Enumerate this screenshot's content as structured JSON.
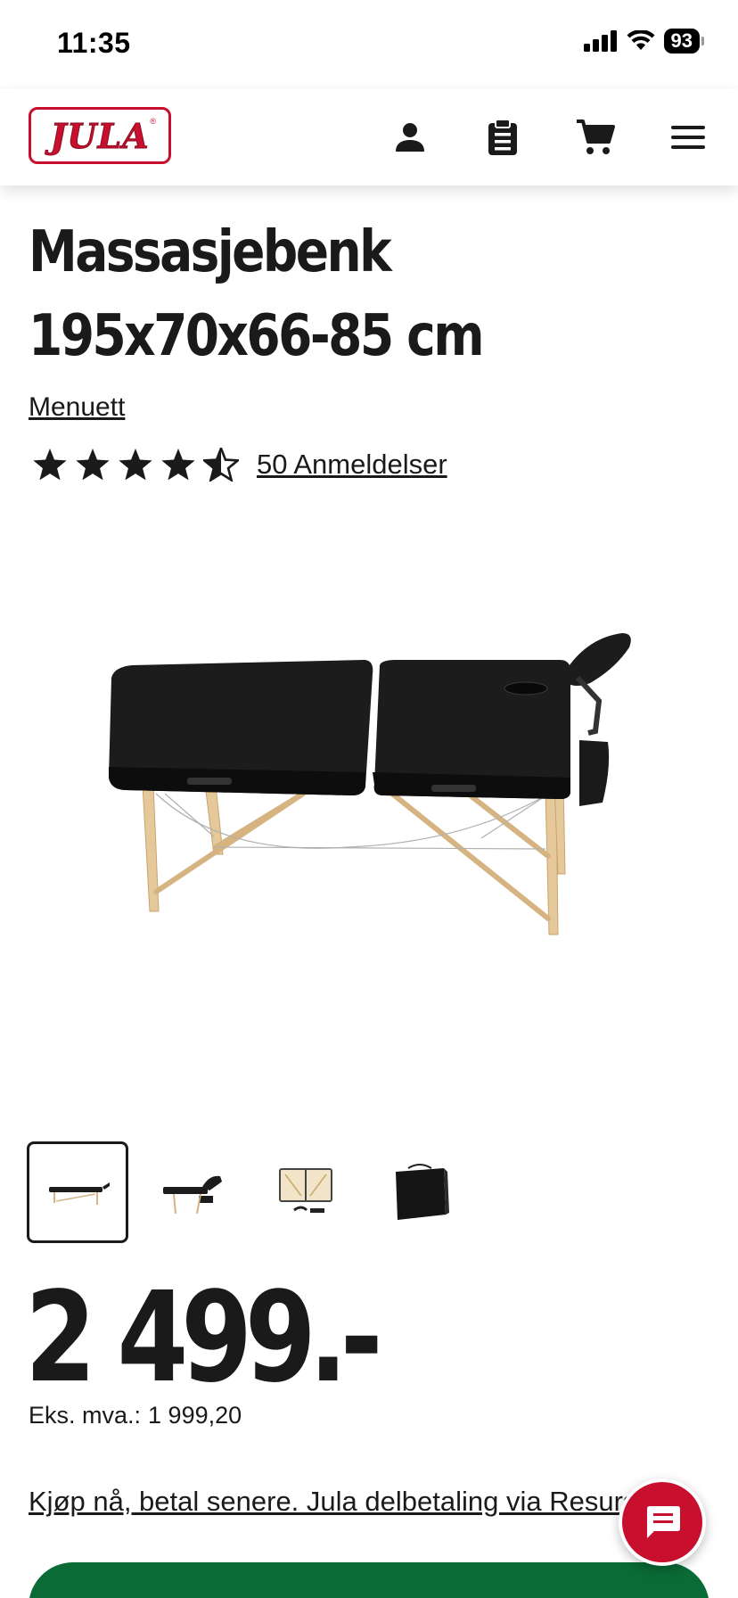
{
  "status_bar": {
    "time": "11:35",
    "battery": "93",
    "icons": [
      "signal-icon",
      "wifi-icon",
      "battery-icon"
    ]
  },
  "header": {
    "logo_text": "JULA",
    "icons": [
      "user-icon",
      "shopping-list-icon",
      "cart-icon",
      "menu-icon"
    ]
  },
  "product": {
    "title": "Massasjebenk 195x70x66-85 cm",
    "brand": "Menuett",
    "rating": 4.5,
    "rating_max": 5,
    "reviews_label": "50 Anmeldelser",
    "thumbnails": [
      "massage-table-side",
      "massage-table-headrest",
      "massage-table-folded-open",
      "carry-bag"
    ],
    "price": "2 499.-",
    "ex_vat_label": "Eks. mva.:",
    "ex_vat_value": "1 999,20",
    "pay_later_link": "Kjøp nå, betal senere. Jula delbetaling via Resurs Bank"
  },
  "colors": {
    "brand_red": "#c8102e",
    "buy_green": "#0a6b36",
    "text": "#1a1a1a"
  }
}
